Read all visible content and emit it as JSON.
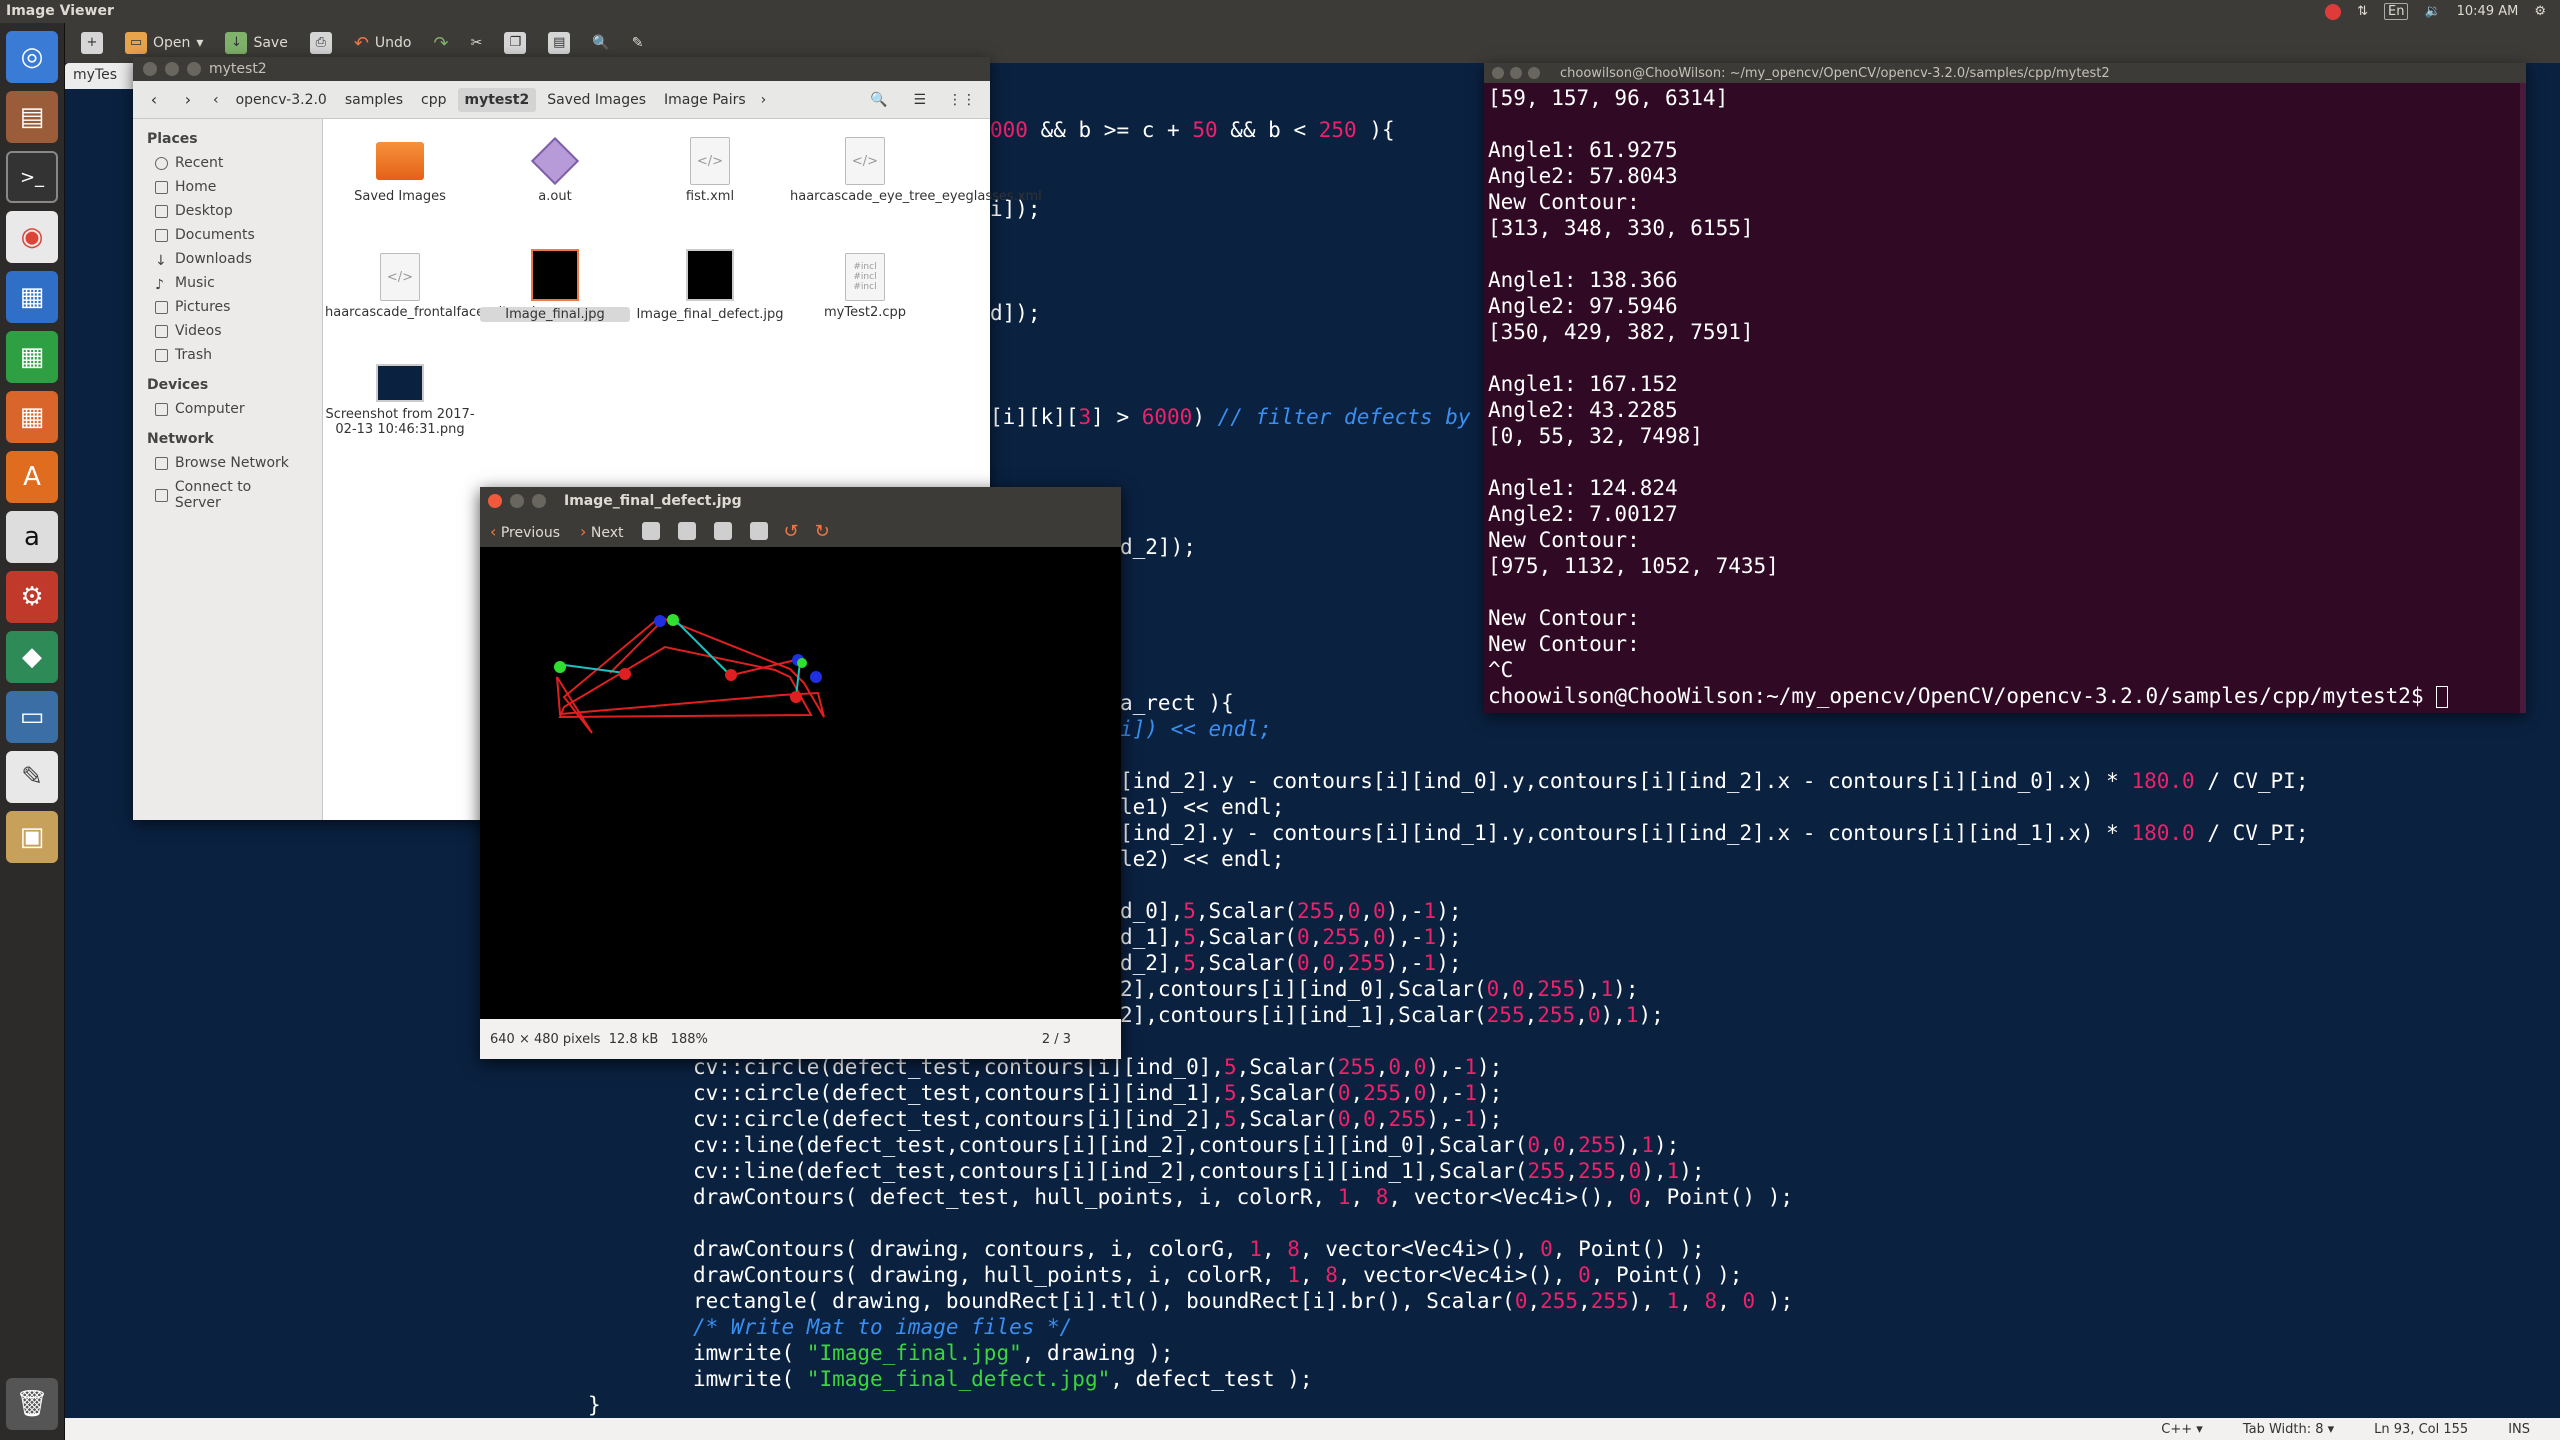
{
  "top_panel": {
    "app_title": "Image Viewer",
    "clock": "10:49 AM",
    "keyboard": "En"
  },
  "edit_toolbar": {
    "open_label": "Open",
    "save_label": "Save",
    "undo_label": "Undo",
    "tab_label": "myTes"
  },
  "file_manager": {
    "title": "mytest2",
    "breadcrumbs": [
      "opencv-3.2.0",
      "samples",
      "cpp",
      "mytest2",
      "Saved Images",
      "Image Pairs"
    ],
    "sidebar": {
      "places_header": "Places",
      "places": [
        "Recent",
        "Home",
        "Desktop",
        "Documents",
        "Downloads",
        "Music",
        "Pictures",
        "Videos",
        "Trash"
      ],
      "devices_header": "Devices",
      "devices": [
        "Computer"
      ],
      "network_header": "Network",
      "network": [
        "Browse Network",
        "Connect to Server"
      ]
    },
    "files": [
      {
        "name": "Saved Images",
        "type": "folder"
      },
      {
        "name": "a.out",
        "type": "exec"
      },
      {
        "name": "fist.xml",
        "type": "xml"
      },
      {
        "name": "haarcascade_eye_tree_eyeglasses.xml",
        "type": "xml"
      },
      {
        "name": "haarcascade_frontalface_alt.xml",
        "type": "xml"
      },
      {
        "name": "Image_final.jpg",
        "type": "image",
        "selected": true
      },
      {
        "name": "Image_final_defect.jpg",
        "type": "image"
      },
      {
        "name": "myTest2.cpp",
        "type": "cpp"
      },
      {
        "name": "Screenshot from 2017-02-13 10:46:31.png",
        "type": "image"
      }
    ]
  },
  "terminal": {
    "title": "choowilson@ChooWilson: ~/my_opencv/OpenCV/opencv-3.2.0/samples/cpp/mytest2",
    "lines": [
      "[59, 157, 96, 6314]",
      "",
      "Angle1: 61.9275",
      "Angle2: 57.8043",
      "New Contour:",
      "[313, 348, 330, 6155]",
      "",
      "Angle1: 138.366",
      "Angle2: 97.5946",
      "[350, 429, 382, 7591]",
      "",
      "Angle1: 167.152",
      "Angle2: 43.2285",
      "[0, 55, 32, 7498]",
      "",
      "Angle1: 124.824",
      "Angle2: 7.00127",
      "New Contour:",
      "[975, 1132, 1052, 7435]",
      "",
      "New Contour:",
      "New Contour:",
      "^C",
      "choowilson@ChooWilson:~/my_opencv/OpenCV/opencv-3.2.0/samples/cpp/mytest2$ "
    ]
  },
  "image_viewer": {
    "title": "Image_final_defect.jpg",
    "previous_label": "Previous",
    "next_label": "Next",
    "dimensions": "640 × 480 pixels",
    "size": "12.8 kB",
    "zoom": "188%",
    "page": "2 / 3"
  },
  "editor_status": {
    "language": "C++ ▾",
    "tab_width": "Tab Width: 8 ▾",
    "position": "Ln 93, Col 155",
    "mode": "INS"
  },
  "colors": {
    "editor_bg": "#0a2140",
    "terminal_bg": "#300a24",
    "number": "#f0206a",
    "string": "#3cd63c",
    "comment": "#3a8ff0",
    "accent_orange": "#f07746"
  }
}
